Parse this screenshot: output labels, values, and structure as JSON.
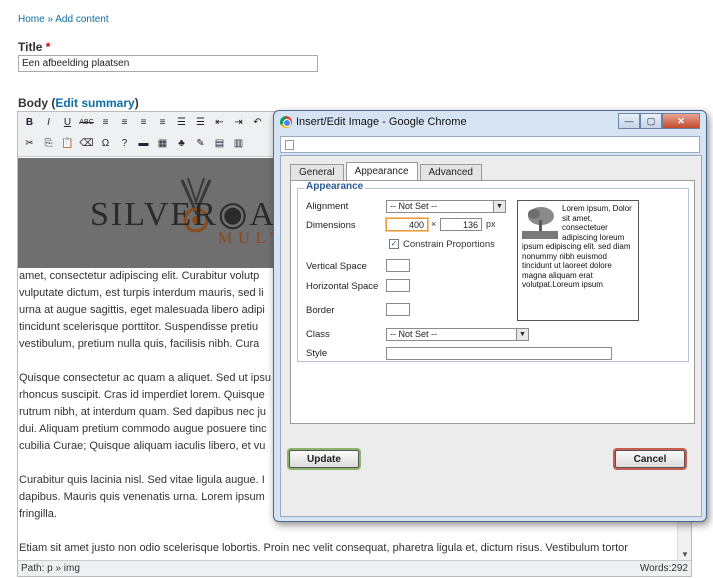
{
  "breadcrumb": {
    "home": "Home",
    "sep": "»",
    "current": "Add content"
  },
  "title_field": {
    "label": "Title",
    "required": "*",
    "value": "Een afbeelding plaatsen"
  },
  "body_field": {
    "label": "Body",
    "open": "(",
    "link": "Edit summary",
    "close": ")"
  },
  "toolbar": {
    "row1": [
      "B",
      "I",
      "U",
      "ABC",
      "≡",
      "≡",
      "≡",
      "≡",
      "☰",
      "☰",
      "⇤",
      "⇥",
      "↶"
    ],
    "row2": [
      "✂",
      "⎘",
      "📋",
      "⌫",
      "Ω",
      "?",
      "▬",
      "▦",
      "♣",
      "✎",
      "▤",
      "▥"
    ]
  },
  "banner": {
    "logo_main": "SILVER◉ARR",
    "logo_sub": "MULT"
  },
  "content": {
    "paragraphs": [
      [
        "amet, consectetur adipiscing elit. Curabitur volutp",
        "vulputate dictum, est turpis interdum mauris, sed li",
        "urna at augue sagittis, eget malesuada libero adipi",
        "tincidunt scelerisque porttitor. Suspendisse pretiu",
        "vestibulum, pretium nulla quis, facilisis nibh. Cura"
      ],
      [
        "Quisque consectetur ac quam a aliquet. Sed ut ipsu",
        "rhoncus suscipit. Cras id imperdiet lorem. Quisque",
        "rutrum nibh, at interdum quam. Sed dapibus nec ju",
        "dui. Aliquam pretium commodo augue posuere tinc",
        "cubilia Curae; Quisque aliquam iaculis libero, et vu"
      ],
      [
        "Curabitur quis lacinia nisl. Sed vitae ligula augue. I",
        "dapibus. Mauris quis venenatis urna. Lorem ipsum",
        "fringilla."
      ],
      [
        "Etiam sit amet justo non odio scelerisque lobortis. Proin nec velit consequat, pharetra ligula et, dictum risus. Vestibulum tortor"
      ]
    ]
  },
  "statusbar": {
    "path": "Path: p » img",
    "words": "Words:292"
  },
  "dialog": {
    "title": "Insert/Edit Image - Google Chrome",
    "window_buttons": {
      "minimize": "—",
      "maximize": "▢",
      "close": "✕"
    },
    "tabs": [
      {
        "label": "General",
        "active": false
      },
      {
        "label": "Appearance",
        "active": true
      },
      {
        "label": "Advanced",
        "active": false
      }
    ],
    "legend": "Appearance",
    "alignment": {
      "label": "Alignment",
      "value": "-- Not Set --"
    },
    "dimensions": {
      "label": "Dimensions",
      "width": "400",
      "times": "×",
      "height": "136",
      "unit": "px"
    },
    "constrain": {
      "label": "Constrain Proportions",
      "checked": true,
      "mark": "✓"
    },
    "vertical_space": {
      "label": "Vertical Space",
      "value": ""
    },
    "horizontal_space": {
      "label": "Horizontal Space",
      "value": ""
    },
    "border": {
      "label": "Border",
      "value": ""
    },
    "class": {
      "label": "Class",
      "value": "-- Not Set --"
    },
    "style": {
      "label": "Style",
      "value": ""
    },
    "preview_text": "Lorem ipsum, Dolor sit amet, consectetuer adipiscing loreum ipsum edipiscing elit. sed diam nonummy nibh euismod tincidunt ut laoreet dolore magna aliquam erat volutpat.Loreum ipsum",
    "update_label": "Update",
    "cancel_label": "Cancel"
  },
  "colors": {
    "link": "#0b6fa4",
    "required": "#cc0000",
    "legend": "#2b5b93",
    "focus": "#e79a3c"
  }
}
